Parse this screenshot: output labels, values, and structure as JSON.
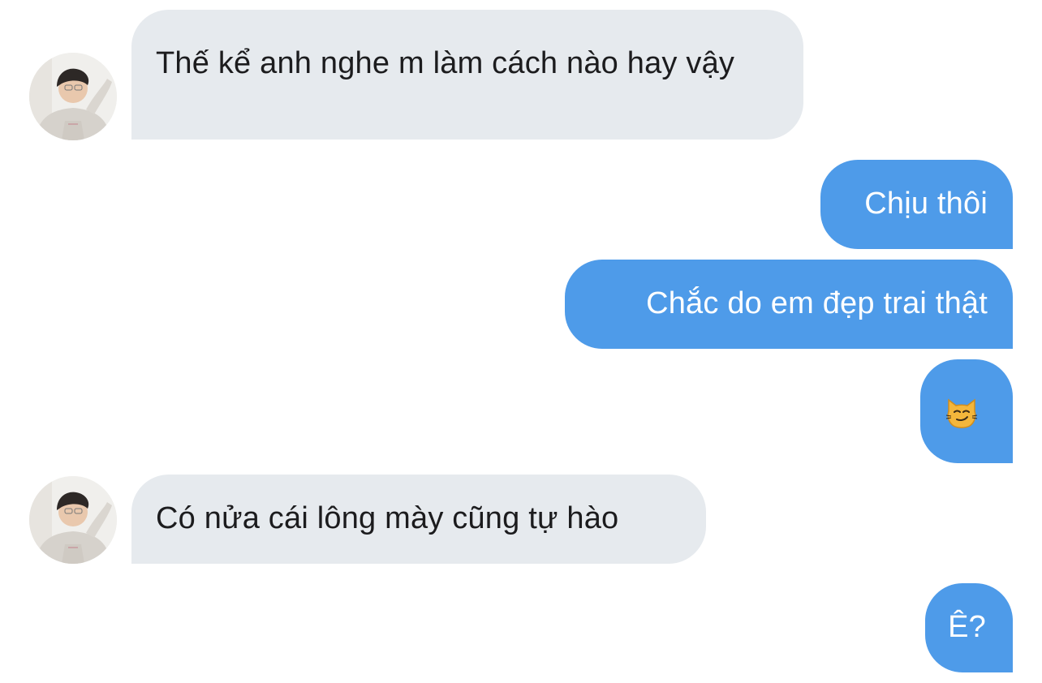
{
  "conversation": {
    "messages": [
      {
        "sender": "other",
        "text": "Thế kể anh nghe m làm cách nào hay vậy"
      },
      {
        "sender": "me",
        "text": "Chịu thôi"
      },
      {
        "sender": "me",
        "text": "Chắc do em đẹp trai thật"
      },
      {
        "sender": "me",
        "emoji": "smirking-cat-face"
      },
      {
        "sender": "other",
        "text": "Có nửa cái lông mày cũng tự hào"
      },
      {
        "sender": "me",
        "text": "Ê?"
      }
    ]
  },
  "colors": {
    "incoming_bubble": "#e6eaee",
    "outgoing_bubble": "#4e9be9",
    "incoming_text": "#1c1c1e",
    "outgoing_text": "#ffffff",
    "background": "#ffffff"
  }
}
